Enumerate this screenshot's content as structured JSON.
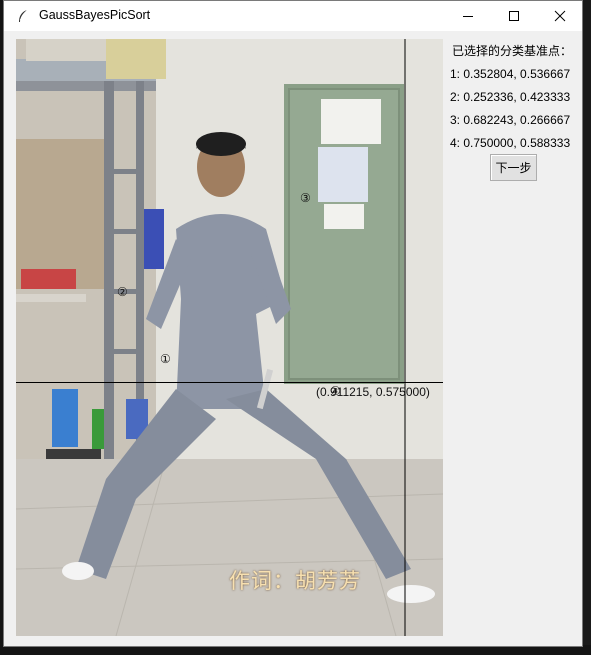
{
  "window": {
    "title": "GaussBayesPicSort",
    "icon": "feather-icon"
  },
  "titlebar_buttons": {
    "minimize": "minimize-icon",
    "maximize": "maximize-icon",
    "close": "close-icon"
  },
  "canvas": {
    "markers": [
      "①",
      "②",
      "③",
      "④"
    ],
    "coordinate_readout": "(0.911215, 0.575000)",
    "caption": "作词：胡芳芳"
  },
  "panel": {
    "title": "已选择的分类基准点：",
    "points": [
      "1: 0.352804, 0.536667",
      "2: 0.252336, 0.423333",
      "3: 0.682243, 0.266667",
      "4: 0.750000, 0.588333"
    ],
    "next_button_label": "下一步"
  }
}
